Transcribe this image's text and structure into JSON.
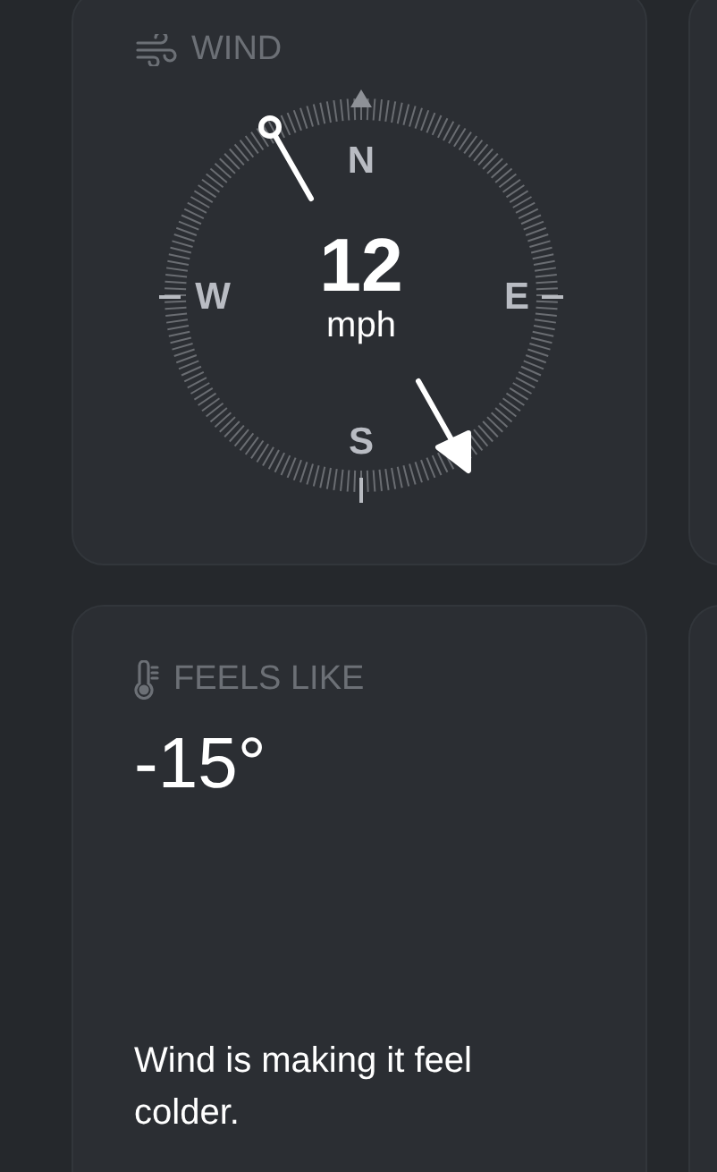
{
  "wind": {
    "title": "WIND",
    "speed": "12",
    "unit": "mph",
    "cardinals": [
      {
        "label": "N",
        "kind": "north"
      },
      {
        "label": "E",
        "kind": "east"
      },
      {
        "label": "S",
        "kind": "south"
      },
      {
        "label": "W",
        "kind": "west"
      }
    ]
  },
  "feels_like": {
    "title": "FEELS LIKE",
    "value": "-15°",
    "description": "Wind is making it feel colder."
  }
}
